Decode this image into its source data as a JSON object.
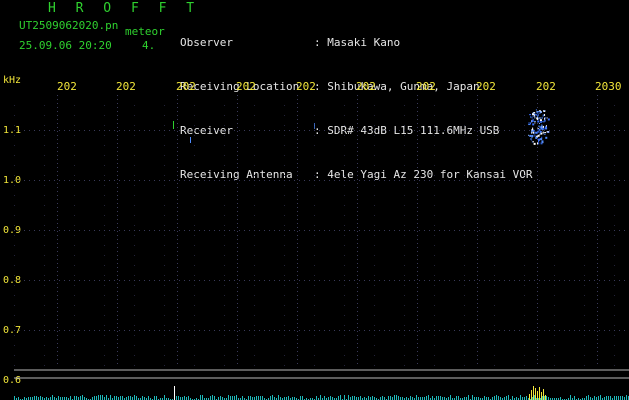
{
  "header": {
    "title": "H R O F F T",
    "filename": "UT2509062020.pn",
    "mode": "meteor",
    "timestamp": "25.09.06 20:20",
    "count": "4."
  },
  "meta": {
    "labels": [
      "Observer",
      "Receiving Location",
      "Receiver",
      "Receiving Antenna"
    ],
    "values": [
      ": Masaki Kano",
      ": Shibukawa, Gunma, Japan",
      ": SDR# 43dB L15 111.6MHz USB",
      ": 4ele Yagi Az 230 for Kansai VOR"
    ]
  },
  "axis": {
    "unit": "kHz",
    "y_ticks": [
      "1.1",
      "1.0",
      "0.9",
      "0.8",
      "0.7",
      "0.6"
    ],
    "x_ticks": [
      "202",
      "202",
      "202",
      "202",
      "202",
      "202",
      "202",
      "202",
      "202",
      "2030"
    ]
  },
  "colors": {
    "green": "#2fd12f",
    "yellow": "#f2e63a",
    "meteor": "#4f8cff",
    "spectrum": "#23d8d8"
  }
}
